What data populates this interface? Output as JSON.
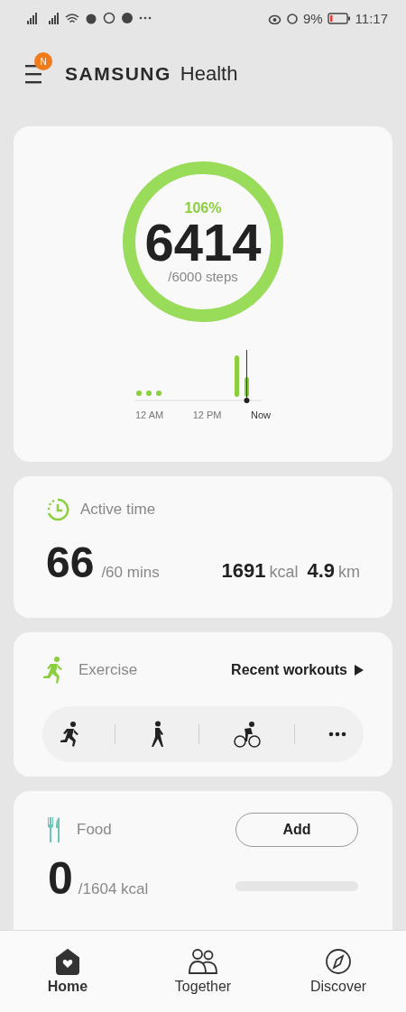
{
  "status_bar": {
    "battery": "9%",
    "time": "11:17"
  },
  "header": {
    "badge": "N",
    "brand": "SAMSUNG",
    "title": "Health"
  },
  "steps": {
    "percent": "106%",
    "count": "6414",
    "goal": "/6000 steps",
    "level": 1,
    "axis_labels": [
      "12 AM",
      "12 PM",
      "Now"
    ]
  },
  "active_time": {
    "title": "Active time",
    "value": "66",
    "goal": "/60 mins",
    "stats": [
      {
        "value": "1691",
        "unit": "kcal"
      },
      {
        "value": "4.9",
        "unit": "km"
      }
    ]
  },
  "exercise": {
    "title": "Exercise",
    "link": "Recent workouts",
    "shortcuts": [
      {
        "kind": "run"
      },
      {
        "kind": "walk"
      },
      {
        "kind": "cycle"
      },
      {
        "kind": "more"
      }
    ]
  },
  "food": {
    "title": "Food",
    "button": "Add",
    "value": "0",
    "goal": "/1604 kcal",
    "level": 0
  },
  "nav": [
    {
      "label": "Home",
      "kind": "home",
      "selected": true
    },
    {
      "label": "Together",
      "kind": "together",
      "selected": false
    },
    {
      "label": "Discover",
      "kind": "discover",
      "selected": false
    }
  ]
}
